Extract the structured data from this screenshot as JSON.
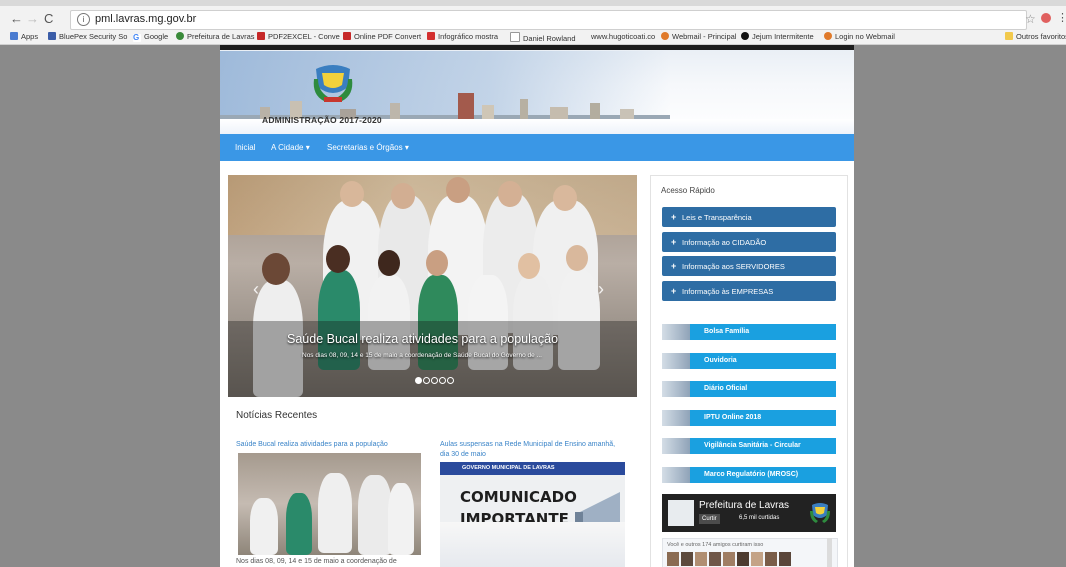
{
  "browser": {
    "url": "pml.lavras.mg.gov.br",
    "bookmarks": [
      "Apps",
      "BluePex Security So",
      "Google",
      "Prefeitura de Lavras",
      "PDF2EXCEL - Conve",
      "Online PDF Convert",
      "Infográfico mostra",
      "Daniel Rowland",
      "www.hugoticoati.co",
      "Webmail - Principal",
      "Jejum Intermitente",
      "Login no Webmail",
      "Outros favoritos"
    ]
  },
  "site": {
    "banner_title": "ADMINISTRAÇÃO 2017-2020",
    "nav": [
      "Inicial",
      "A Cidade ▾",
      "Secretarias e Órgãos ▾"
    ]
  },
  "carousel": {
    "title": "Saúde Bucal realiza atividades para a população",
    "subtitle": "Nos dias 08, 09, 14 e 15 de maio a coordenação de Saúde Bucal do Governo de ..."
  },
  "news": {
    "heading": "Notícias Recentes",
    "items": [
      {
        "title": "Saúde Bucal realiza atividades para a população",
        "excerpt": "Nos dias 08, 09, 14 e 15 de maio a coordenação de"
      },
      {
        "title": "Aulas suspensas na Rede Municipal de Ensino amanhã, dia 30 de maio",
        "banner": "GOVERNO MUNICIPAL DE LAVRAS",
        "image_text": "COMUNICADO IMPORTANTE"
      }
    ]
  },
  "sidebar": {
    "heading": "Acesso Rápido",
    "quick_links": [
      "Leis e Transparência",
      "Informação ao CIDADÃO",
      "Informação aos SERVIDORES",
      "Informação às EMPRESAS"
    ],
    "links": [
      "Bolsa Família",
      "Ouvidoria",
      "Diário Oficial",
      "IPTU Online 2018",
      "Vigilância Sanitária - Circular",
      "Marco Regulatório (MROSC)"
    ],
    "facebook": {
      "page_name": "Prefeitura de Lavras",
      "like_label": "Curtir",
      "likes": "6,5 mil curtidas",
      "friends_text": "Você e outros 174 amigos curtiram isso"
    }
  }
}
